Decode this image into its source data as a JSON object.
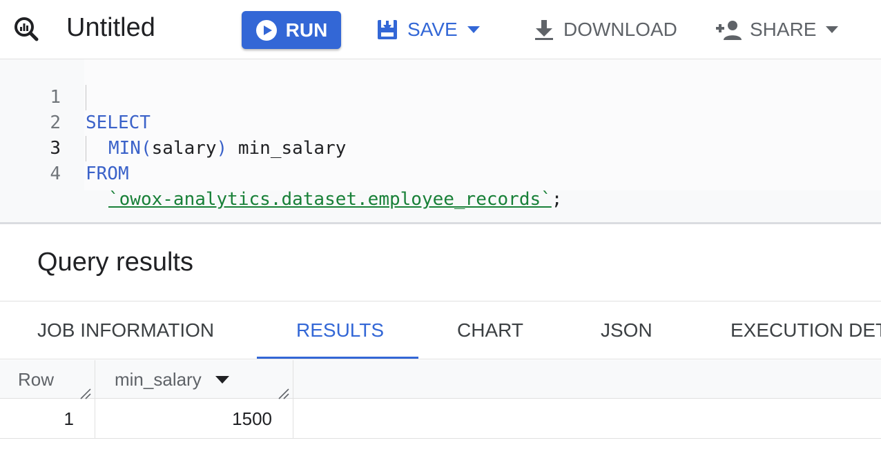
{
  "toolbar": {
    "title": "Untitled",
    "run_label": "RUN",
    "save_label": "SAVE",
    "download_label": "DOWNLOAD",
    "share_label": "SHARE",
    "accent_color": "#3367d6"
  },
  "editor": {
    "lines": [
      {
        "number": "1",
        "keyword": "SELECT"
      },
      {
        "number": "2",
        "func": "MIN(",
        "arg": "salary",
        "close": ")",
        "alias": " min_salary"
      },
      {
        "number": "3",
        "keyword": "FROM"
      },
      {
        "number": "4",
        "table": "`owox-analytics.dataset.employee_records`",
        "terminator": ";"
      }
    ]
  },
  "results": {
    "title": "Query results",
    "tabs": [
      {
        "label": "JOB INFORMATION"
      },
      {
        "label": "RESULTS"
      },
      {
        "label": "CHART"
      },
      {
        "label": "JSON"
      },
      {
        "label": "EXECUTION DETAILS"
      }
    ],
    "active_tab": "RESULTS",
    "columns": [
      "Row",
      "min_salary"
    ],
    "rows": [
      {
        "row": "1",
        "min_salary": "1500"
      }
    ]
  }
}
